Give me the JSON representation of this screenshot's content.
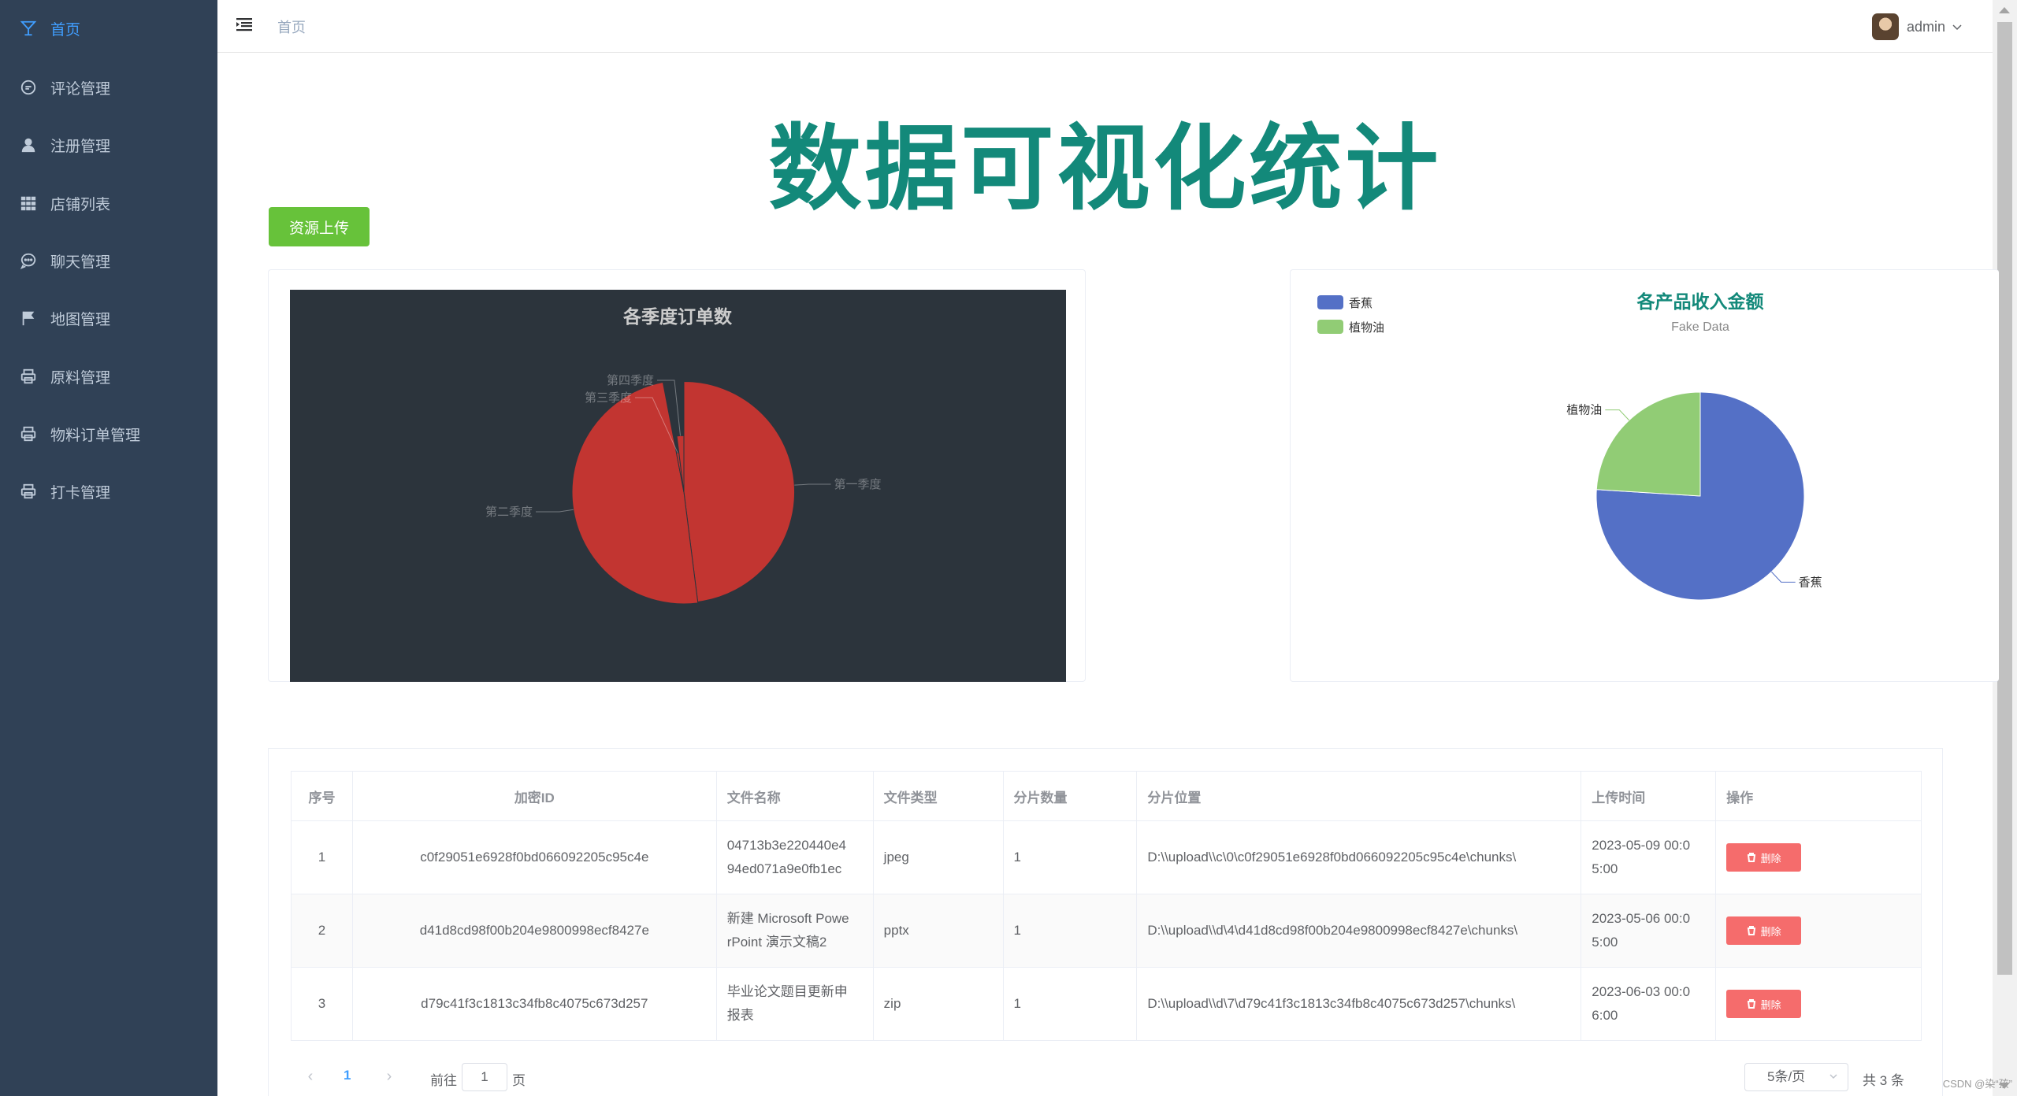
{
  "sidebar": {
    "items": [
      {
        "label": "首页",
        "icon": "cocktail-icon"
      },
      {
        "label": "评论管理",
        "icon": "chat-dot-icon"
      },
      {
        "label": "注册管理",
        "icon": "user-icon"
      },
      {
        "label": "店铺列表",
        "icon": "grid-icon"
      },
      {
        "label": "聊天管理",
        "icon": "chat-bubble-icon"
      },
      {
        "label": "地图管理",
        "icon": "flag-icon"
      },
      {
        "label": "原料管理",
        "icon": "printer-icon"
      },
      {
        "label": "物料订单管理",
        "icon": "printer-icon"
      },
      {
        "label": "打卡管理",
        "icon": "printer-icon"
      }
    ]
  },
  "header": {
    "breadcrumb": "首页",
    "username": "admin"
  },
  "main": {
    "title": "数据可视化统计",
    "upload_button": "资源上传"
  },
  "chart_data": [
    {
      "type": "pie",
      "title": "各季度订单数",
      "style": "dark rose pie",
      "background": "#2c343c",
      "color": "#c23531",
      "slices": [
        {
          "name": "第一季度",
          "value": 48
        },
        {
          "name": "第二季度",
          "value": 49
        },
        {
          "name": "第三季度",
          "value": 1
        },
        {
          "name": "第四季度",
          "value": 2
        }
      ]
    },
    {
      "type": "pie",
      "title": "各产品收入金额",
      "subtitle": "Fake Data",
      "legend_position": "top-left",
      "colors": {
        "香蕉": "#5470c6",
        "植物油": "#91cc75"
      },
      "slices": [
        {
          "name": "香蕉",
          "value": 76
        },
        {
          "name": "植物油",
          "value": 24
        }
      ]
    }
  ],
  "table": {
    "headers": [
      "序号",
      "加密ID",
      "文件名称",
      "文件类型",
      "分片数量",
      "分片位置",
      "上传时间",
      "操作"
    ],
    "delete_label": "删除",
    "rows": [
      {
        "index": "1",
        "id": "c0f29051e6928f0bd066092205c95c4e",
        "name_l1": "04713b3e220440e4",
        "name_l2": "94ed071a9e0fb1ec",
        "type": "jpeg",
        "count": "1",
        "path": "D:\\\\upload\\\\c\\0\\c0f29051e6928f0bd066092205c95c4e\\chunks\\",
        "time_l1": "2023-05-09 00:0",
        "time_l2": "5:00"
      },
      {
        "index": "2",
        "id": "d41d8cd98f00b204e9800998ecf8427e",
        "name_l1": "新建 Microsoft Powe",
        "name_l2": "rPoint 演示文稿2",
        "type": "pptx",
        "count": "1",
        "path": "D:\\\\upload\\\\d\\4\\d41d8cd98f00b204e9800998ecf8427e\\chunks\\",
        "time_l1": "2023-05-06 00:0",
        "time_l2": "5:00"
      },
      {
        "index": "3",
        "id": "d79c41f3c1813c34fb8c4075c673d257",
        "name_l1": "毕业论文题目更新申",
        "name_l2": "报表",
        "type": "zip",
        "count": "1",
        "path": "D:\\\\upload\\\\d\\7\\d79c41f3c1813c34fb8c4075c673d257\\chunks\\",
        "time_l1": "2023-06-03 00:0",
        "time_l2": "6:00"
      }
    ]
  },
  "pagination": {
    "current_page": "1",
    "goto_prefix": "前往",
    "goto_value": "1",
    "goto_suffix": "页",
    "page_size": "5条/页",
    "total": "共 3 条"
  },
  "watermark": "CSDN @染“孩”"
}
